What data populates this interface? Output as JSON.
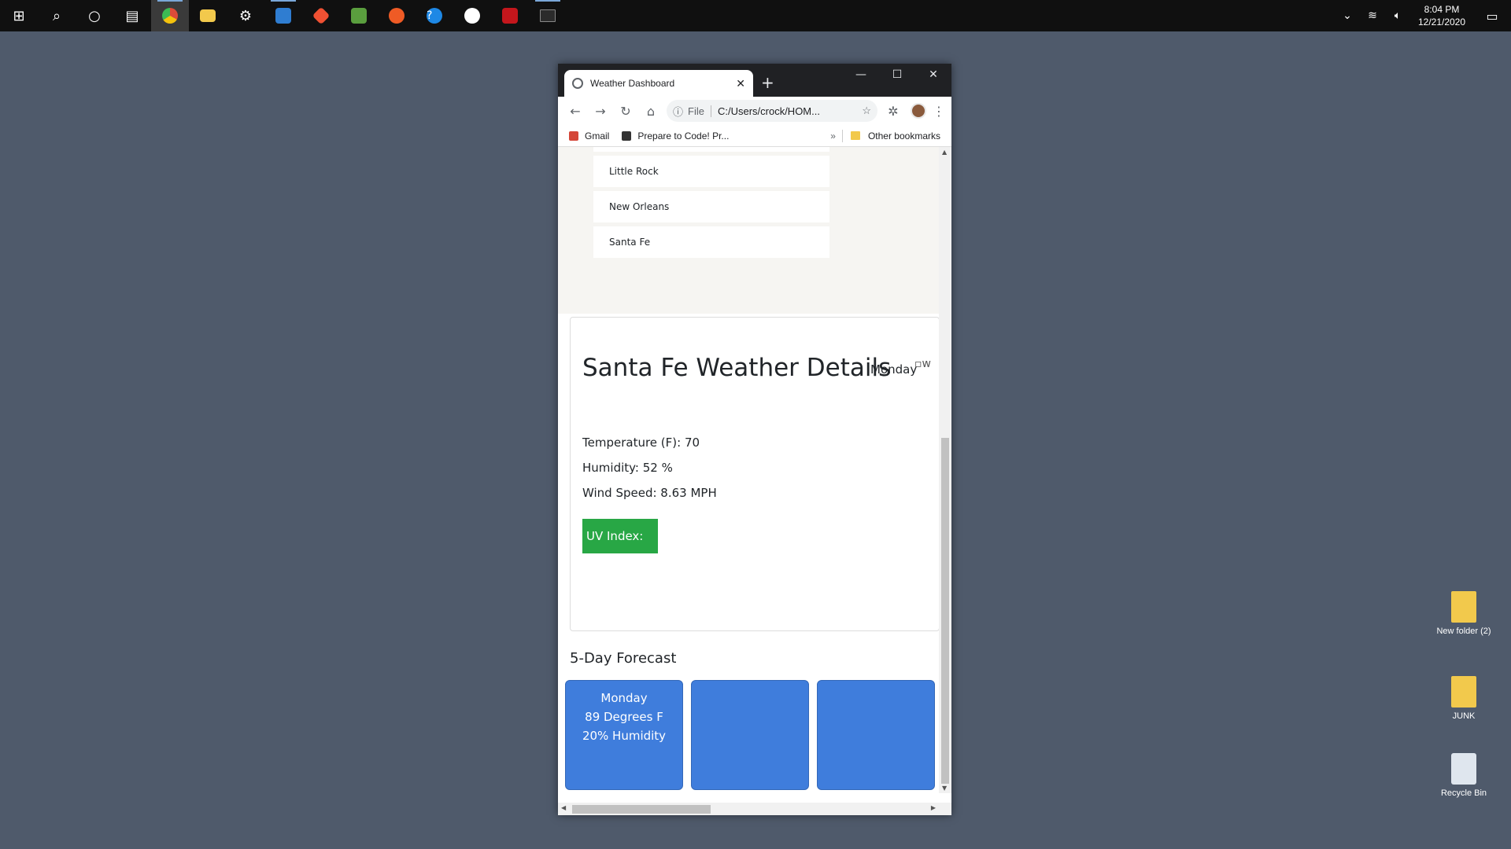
{
  "taskbar": {
    "apps": [
      {
        "name": "start-icon",
        "glyph": "⊞",
        "color": "#ffffff"
      },
      {
        "name": "search-icon",
        "glyph": "⌕",
        "color": "#ffffff"
      },
      {
        "name": "cortana-icon",
        "glyph": "○",
        "color": "#ffffff"
      },
      {
        "name": "task-view-icon",
        "glyph": "▤",
        "color": "#ffffff"
      },
      {
        "name": "chrome-icon",
        "color": "#dd4b39"
      },
      {
        "name": "file-explorer-icon",
        "color": "#f2c94c"
      },
      {
        "name": "settings-icon",
        "glyph": "⚙",
        "color": "#ffffff"
      },
      {
        "name": "vscode-icon",
        "color": "#2f7dd1"
      },
      {
        "name": "git-icon",
        "color": "#f05133"
      },
      {
        "name": "node-icon",
        "color": "#5a9e3e"
      },
      {
        "name": "postman-icon",
        "color": "#ef5b25"
      },
      {
        "name": "help-icon",
        "color": "#1e88e5"
      },
      {
        "name": "slack-icon",
        "color": "#e01e5a"
      },
      {
        "name": "heidisql-icon",
        "color": "#c4161c"
      },
      {
        "name": "terminal-icon",
        "color": "#2b2b2b"
      }
    ],
    "clock": {
      "time": "8:04 PM",
      "date": "12/21/2020"
    }
  },
  "browser": {
    "tab_title": "Weather Dashboard",
    "address": {
      "scheme_label": "File",
      "url": "C:/Users/crock/HOM..."
    },
    "bookmarks": [
      {
        "label": "Gmail",
        "color": "#d44638"
      },
      {
        "label": "Prepare to Code! Pr...",
        "color": "#333333"
      }
    ],
    "other_bookmarks": "Other bookmarks",
    "more_bookmarks": "»"
  },
  "page": {
    "cities": [
      "Little Rock",
      "New Orleans",
      "Santa Fe"
    ],
    "details": {
      "title": "Santa Fe Weather Details",
      "day": "Monday",
      "icon_alt": "w",
      "temperature": "Temperature (F): 70",
      "humidity": "Humidity: 52 %",
      "wind": "Wind Speed: 8.63 MPH",
      "uv_label": "UV Index:"
    },
    "forecast": {
      "title": "5-Day Forecast",
      "cards": [
        {
          "day": "Monday",
          "temp": "89 Degrees F",
          "humidity": "20% Humidity"
        },
        {
          "day": "",
          "temp": "",
          "humidity": ""
        },
        {
          "day": "",
          "temp": "",
          "humidity": ""
        }
      ]
    },
    "colors": {
      "uv_badge": "#28a745",
      "forecast_card": "#3f7ddc"
    }
  },
  "desktop": {
    "icons": [
      {
        "label": "New folder (2)"
      },
      {
        "label": "JUNK"
      },
      {
        "label": "Recycle Bin"
      }
    ]
  }
}
